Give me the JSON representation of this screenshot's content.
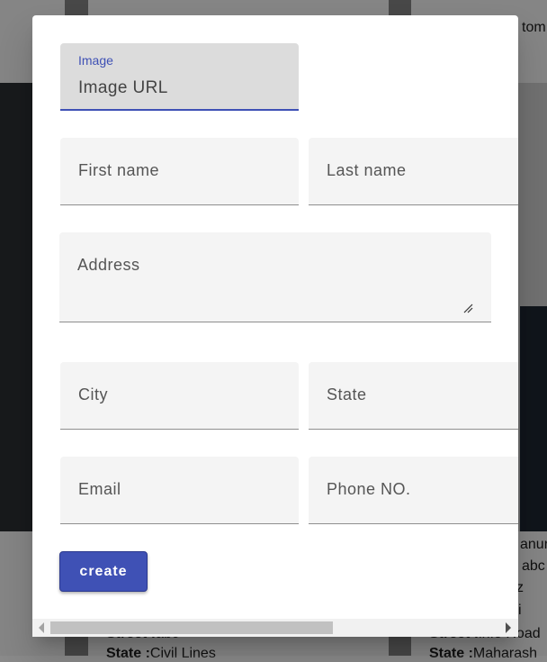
{
  "background": {
    "card_right_header_partial": "tom",
    "right_card_lines": [
      {
        "label": "",
        "value": "anur"
      },
      {
        "label": "",
        "value": "abc"
      },
      {
        "label": "",
        "value": "z"
      },
      {
        "label": "",
        "value": "i"
      },
      {
        "label": "Street :",
        "value": "lnfo Road"
      },
      {
        "label": "State :",
        "value": "Maharash"
      }
    ],
    "left_card_lines": [
      {
        "label": "Street :",
        "value": "abc"
      },
      {
        "label": "State :",
        "value": "Civil Lines"
      }
    ]
  },
  "dialog": {
    "image_field": {
      "label": "Image",
      "value": "Image URL"
    },
    "first_name": {
      "label": "First name"
    },
    "last_name": {
      "label": "Last name"
    },
    "address": {
      "label": "Address"
    },
    "city": {
      "label": "City"
    },
    "state": {
      "label": "State"
    },
    "email": {
      "label": "Email"
    },
    "phone": {
      "label": "Phone NO."
    },
    "create_label": "create"
  },
  "colors": {
    "primary": "#3f51b5",
    "field_bg": "#f4f4f4",
    "focused_field_bg": "#dcdcdc"
  }
}
